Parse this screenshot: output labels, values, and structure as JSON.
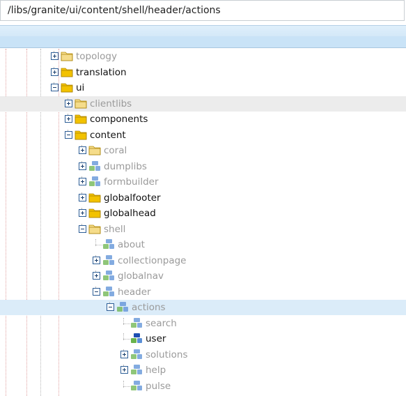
{
  "path": {
    "value": "/libs/granite/ui/content/shell/header/actions"
  },
  "tree": {
    "rows": [
      {
        "label": "topology",
        "icon": "folder-icon",
        "toggle": "plus",
        "faded": true
      },
      {
        "label": "translation",
        "icon": "folder-icon",
        "toggle": "plus",
        "faded": false
      },
      {
        "label": "ui",
        "icon": "folder-icon",
        "toggle": "minus",
        "faded": false
      },
      {
        "label": "clientlibs",
        "icon": "folder-icon",
        "toggle": "plus",
        "faded": true
      },
      {
        "label": "components",
        "icon": "folder-icon",
        "toggle": "plus",
        "faded": false
      },
      {
        "label": "content",
        "icon": "folder-icon",
        "toggle": "minus",
        "faded": false
      },
      {
        "label": "coral",
        "icon": "folder-icon",
        "toggle": "plus",
        "faded": true
      },
      {
        "label": "dumplibs",
        "icon": "node-icon",
        "toggle": "plus",
        "faded": true
      },
      {
        "label": "formbuilder",
        "icon": "node-icon",
        "toggle": "plus",
        "faded": true
      },
      {
        "label": "globalfooter",
        "icon": "folder-icon",
        "toggle": "plus",
        "faded": false
      },
      {
        "label": "globalhead",
        "icon": "folder-icon",
        "toggle": "plus",
        "faded": false
      },
      {
        "label": "shell",
        "icon": "folder-icon",
        "toggle": "minus",
        "faded": true
      },
      {
        "label": "about",
        "icon": "node-icon",
        "toggle": "none",
        "faded": true
      },
      {
        "label": "collectionpage",
        "icon": "node-icon",
        "toggle": "plus",
        "faded": true
      },
      {
        "label": "globalnav",
        "icon": "node-icon",
        "toggle": "plus",
        "faded": true
      },
      {
        "label": "header",
        "icon": "node-icon",
        "toggle": "minus",
        "faded": true
      },
      {
        "label": "actions",
        "icon": "node-icon",
        "toggle": "minus",
        "faded": true
      },
      {
        "label": "search",
        "icon": "node-icon",
        "toggle": "none",
        "faded": true
      },
      {
        "label": "user",
        "icon": "node-highlighted-icon",
        "toggle": "none",
        "faded": false
      },
      {
        "label": "solutions",
        "icon": "node-icon",
        "toggle": "plus",
        "faded": true
      },
      {
        "label": "help",
        "icon": "node-icon",
        "toggle": "plus",
        "faded": true
      },
      {
        "label": "pulse",
        "icon": "node-icon",
        "toggle": "none",
        "faded": true
      }
    ]
  },
  "colors": {
    "selection_highlight": "#dbecf9",
    "hover_highlight": "#ececec",
    "folder_active": "#f2c200",
    "folder_faded": "#f5dc8a",
    "node_blue": "#5a8fd6",
    "node_green": "#69b34c",
    "node_dark_blue": "#1d4fb3"
  }
}
